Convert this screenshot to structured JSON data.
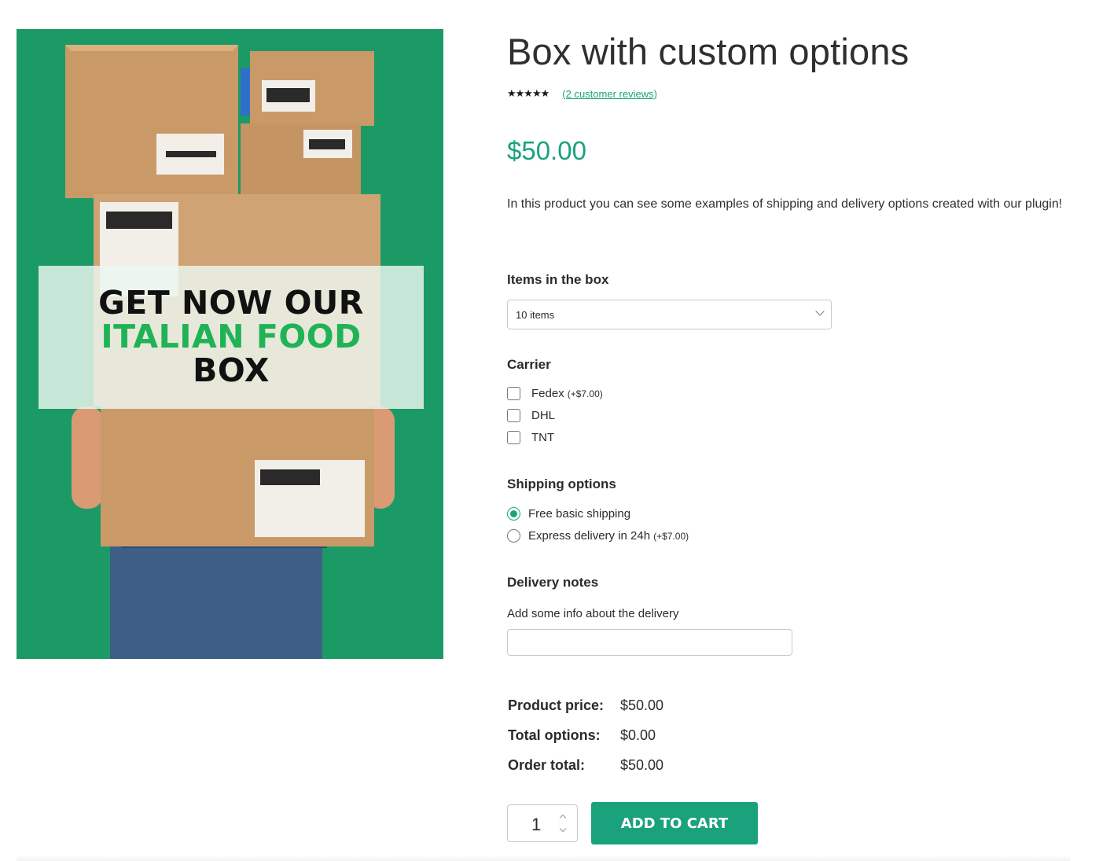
{
  "product": {
    "title": "Box with custom options",
    "rating_stars": "★★★★★",
    "reviews_link": "(2 customer reviews)",
    "price": "$50.00",
    "description": "In this product you can see some examples of shipping and delivery options created with our plugin!"
  },
  "image": {
    "promo_line1": "GET NOW OUR",
    "promo_line2": "ITALIAN FOOD",
    "promo_line3": "BOX"
  },
  "options": {
    "items_label": "Items in the box",
    "items_selected": "10 items",
    "carrier_label": "Carrier",
    "carriers": [
      {
        "name": "Fedex",
        "extra": "(+$7.00)"
      },
      {
        "name": "DHL",
        "extra": ""
      },
      {
        "name": "TNT",
        "extra": ""
      }
    ],
    "shipping_label": "Shipping options",
    "shipping": [
      {
        "name": "Free basic shipping",
        "extra": "",
        "checked": true
      },
      {
        "name": "Express delivery in 24h",
        "extra": "(+$7.00)",
        "checked": false
      }
    ],
    "notes_label": "Delivery notes",
    "notes_hint": "Add some info about the delivery",
    "notes_value": ""
  },
  "totals": {
    "product_price_label": "Product price:",
    "product_price": "$50.00",
    "total_options_label": "Total options:",
    "total_options": "$0.00",
    "order_total_label": "Order total:",
    "order_total": "$50.00"
  },
  "cart": {
    "quantity": "1",
    "add_label": "Add to cart"
  },
  "colors": {
    "accent": "#1aa27d",
    "image_background": "#1c9a66",
    "promo_highlight": "#1fb356"
  }
}
